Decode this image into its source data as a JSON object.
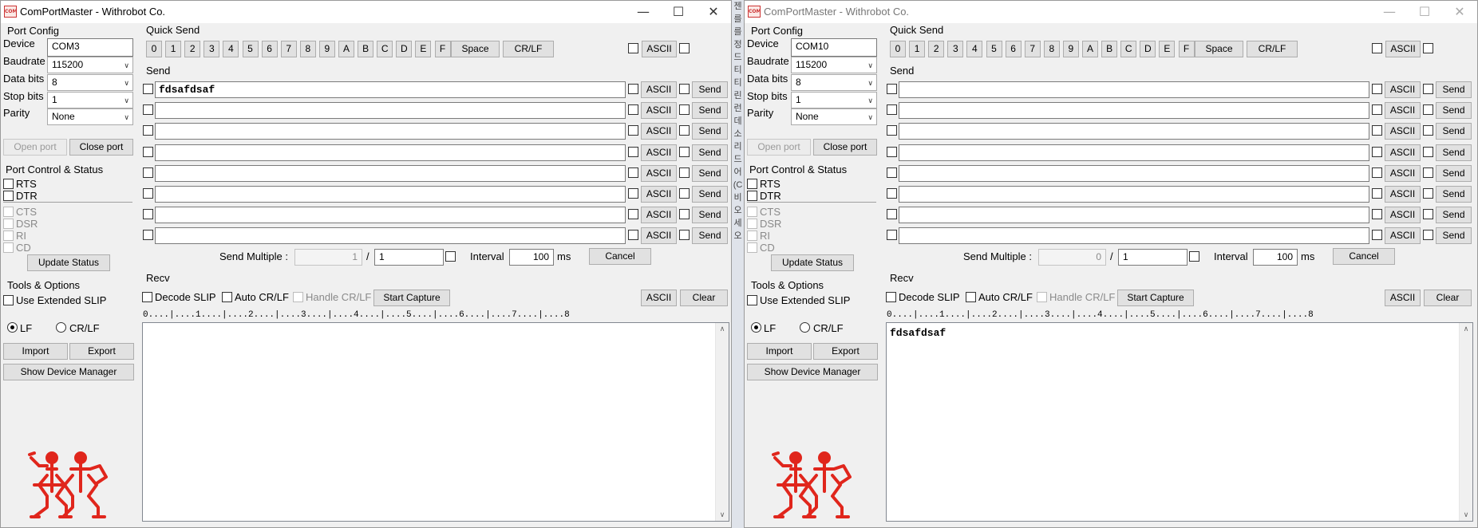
{
  "windows": [
    {
      "title": "ComPortMaster - Withrobot Co.",
      "active": true,
      "port_config": {
        "heading": "Port Config",
        "device_label": "Device",
        "device_value": "COM3",
        "baudrate_label": "Baudrate",
        "baudrate_value": "115200",
        "databits_label": "Data bits",
        "databits_value": "8",
        "stopbits_label": "Stop bits",
        "stopbits_value": "1",
        "parity_label": "Parity",
        "parity_value": "None",
        "open_port": "Open port",
        "close_port": "Close port"
      },
      "port_control": {
        "heading": "Port Control & Status",
        "rts": "RTS",
        "dtr": "DTR",
        "cts": "CTS",
        "dsr": "DSR",
        "ri": "RI",
        "cd": "CD",
        "update_status": "Update Status"
      },
      "tools": {
        "heading": "Tools & Options",
        "use_extended_slip": "Use Extended SLIP",
        "lf": "LF",
        "crlf": "CR/LF",
        "import": "Import",
        "export": "Export",
        "show_device_manager": "Show Device Manager"
      },
      "quick_send": {
        "heading": "Quick Send",
        "keys": [
          "0",
          "1",
          "2",
          "3",
          "4",
          "5",
          "6",
          "7",
          "8",
          "9",
          "A",
          "B",
          "C",
          "D",
          "E",
          "F"
        ],
        "space": "Space",
        "crlf": "CR/LF",
        "ascii": "ASCII"
      },
      "send": {
        "heading": "Send",
        "rows": [
          "fdsafdsaf",
          "",
          "",
          "",
          "",
          "",
          "",
          ""
        ],
        "ascii_label": "ASCII",
        "send_label": "Send",
        "send_multiple_label": "Send Multiple :",
        "multiple_current": "1",
        "multiple_slash": "/",
        "multiple_total": "1",
        "interval_label": "Interval",
        "interval_value": "100",
        "interval_unit": "ms",
        "cancel": "Cancel"
      },
      "recv": {
        "heading": "Recv",
        "decode_slip": "Decode SLIP",
        "auto_crlf": "Auto CR/LF",
        "handle_crlf": "Handle CR/LF",
        "start_capture": "Start Capture",
        "ascii": "ASCII",
        "clear": "Clear",
        "ruler": "0....|....1....|....2....|....3....|....4....|....5....|....6....|....7....|....8",
        "content": ""
      }
    },
    {
      "title": "ComPortMaster - Withrobot Co.",
      "active": false,
      "port_config": {
        "heading": "Port Config",
        "device_label": "Device",
        "device_value": "COM10",
        "baudrate_label": "Baudrate",
        "baudrate_value": "115200",
        "databits_label": "Data bits",
        "databits_value": "8",
        "stopbits_label": "Stop bits",
        "stopbits_value": "1",
        "parity_label": "Parity",
        "parity_value": "None",
        "open_port": "Open port",
        "close_port": "Close port"
      },
      "port_control": {
        "heading": "Port Control & Status",
        "rts": "RTS",
        "dtr": "DTR",
        "cts": "CTS",
        "dsr": "DSR",
        "ri": "RI",
        "cd": "CD",
        "update_status": "Update Status"
      },
      "tools": {
        "heading": "Tools & Options",
        "use_extended_slip": "Use Extended SLIP",
        "lf": "LF",
        "crlf": "CR/LF",
        "import": "Import",
        "export": "Export",
        "show_device_manager": "Show Device Manager"
      },
      "quick_send": {
        "heading": "Quick Send",
        "keys": [
          "0",
          "1",
          "2",
          "3",
          "4",
          "5",
          "6",
          "7",
          "8",
          "9",
          "A",
          "B",
          "C",
          "D",
          "E",
          "F"
        ],
        "space": "Space",
        "crlf": "CR/LF",
        "ascii": "ASCII"
      },
      "send": {
        "heading": "Send",
        "rows": [
          "",
          "",
          "",
          "",
          "",
          "",
          "",
          ""
        ],
        "ascii_label": "ASCII",
        "send_label": "Send",
        "send_multiple_label": "Send Multiple :",
        "multiple_current": "0",
        "multiple_slash": "/",
        "multiple_total": "1",
        "interval_label": "Interval",
        "interval_value": "100",
        "interval_unit": "ms",
        "cancel": "Cancel"
      },
      "recv": {
        "heading": "Recv",
        "decode_slip": "Decode SLIP",
        "auto_crlf": "Auto CR/LF",
        "handle_crlf": "Handle CR/LF",
        "start_capture": "Start Capture",
        "ascii": "ASCII",
        "clear": "Clear",
        "ruler": "0....|....1....|....2....|....3....|....4....|....5....|....6....|....7....|....8",
        "content": "fdsafdsaf"
      }
    }
  ],
  "background_strip_chars": [
    "젠",
    "를",
    "를",
    "정",
    "드",
    "티",
    "티",
    "린",
    "런",
    "데",
    "소",
    "리",
    "드",
    "어",
    "(C",
    "비",
    "오",
    "세",
    "오"
  ],
  "colors": {
    "logo": "#e0261c",
    "window_bg": "#f0f0f0",
    "titlebar": "#ffffff"
  }
}
